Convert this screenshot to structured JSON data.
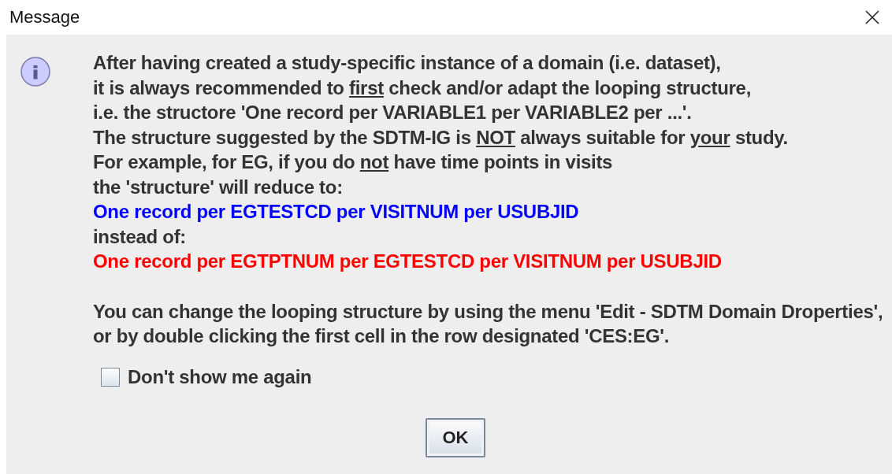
{
  "window": {
    "title": "Message"
  },
  "paragraphs": [
    {
      "lines": [
        {
          "segments": [
            {
              "text": "After having created a study-specific instance of a domain (i.e. dataset),",
              "underline": false
            }
          ]
        },
        {
          "segments": [
            {
              "text": "it is always recommended to ",
              "underline": false
            },
            {
              "text": "first",
              "underline": true
            },
            {
              "text": " check and/or adapt the looping structure,",
              "underline": false
            }
          ]
        },
        {
          "segments": [
            {
              "text": "i.e. the structore 'One record per VARIABLE1 per VARIABLE2 per ...'.",
              "underline": false
            }
          ]
        },
        {
          "segments": [
            {
              "text": "The structure suggested by the SDTM-IG is ",
              "underline": false
            },
            {
              "text": "NOT",
              "underline": true
            },
            {
              "text": " always suitable for ",
              "underline": false
            },
            {
              "text": "your",
              "underline": true
            },
            {
              "text": " study.",
              "underline": false
            }
          ]
        },
        {
          "segments": [
            {
              "text": "For example, for EG, if you do ",
              "underline": false
            },
            {
              "text": "not",
              "underline": true
            },
            {
              "text": " have time points in visits",
              "underline": false
            }
          ]
        },
        {
          "segments": [
            {
              "text": "the 'structure' will reduce to:",
              "underline": false
            }
          ]
        },
        {
          "color": "#0000ff",
          "segments": [
            {
              "text": "One record per EGTESTCD per VISITNUM per USUBJID",
              "underline": false
            }
          ]
        },
        {
          "segments": [
            {
              "text": "instead of:",
              "underline": false
            }
          ]
        },
        {
          "color": "#ff0000",
          "segments": [
            {
              "text": "One record per EGTPTNUM per EGTESTCD per VISITNUM per USUBJID",
              "underline": false
            }
          ]
        }
      ]
    },
    {
      "lines": [
        {
          "segments": [
            {
              "text": "You can change the looping structure by using the menu 'Edit - SDTM Domain Droperties',",
              "underline": false
            }
          ]
        },
        {
          "segments": [
            {
              "text": "or by double clicking the first cell in the row designated 'CES:EG'.",
              "underline": false
            }
          ]
        }
      ]
    }
  ],
  "checkbox": {
    "label": "Don't show me again",
    "checked": false
  },
  "buttons": [
    "OK"
  ]
}
